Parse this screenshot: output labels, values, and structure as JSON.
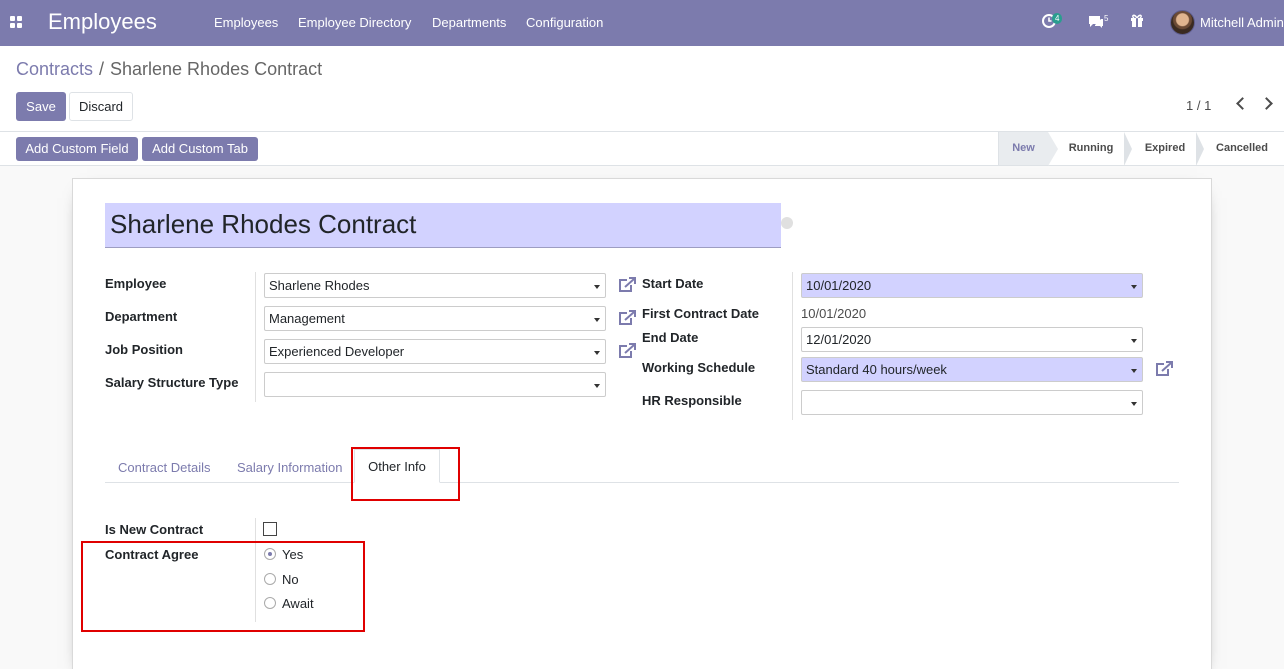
{
  "navbar": {
    "app_title": "Employees",
    "menu": [
      "Employees",
      "Employee Directory",
      "Departments",
      "Configuration"
    ],
    "activity_count": "4",
    "message_count": "5",
    "user_name": "Mitchell Admin"
  },
  "breadcrumb": {
    "parent": "Contracts",
    "separator": "/",
    "current": "Sharlene Rhodes Contract"
  },
  "buttons": {
    "save": "Save",
    "discard": "Discard",
    "add_custom_field": "Add Custom Field",
    "add_custom_tab": "Add Custom Tab"
  },
  "pager": {
    "value": "1 / 1"
  },
  "status_stages": [
    {
      "label": "New",
      "active": true
    },
    {
      "label": "Running",
      "active": false
    },
    {
      "label": "Expired",
      "active": false
    },
    {
      "label": "Cancelled",
      "active": false
    }
  ],
  "form": {
    "title": "Sharlene Rhodes Contract",
    "left": {
      "employee_label": "Employee",
      "employee_value": "Sharlene Rhodes",
      "department_label": "Department",
      "department_value": "Management",
      "job_position_label": "Job Position",
      "job_position_value": "Experienced Developer",
      "salary_structure_label": "Salary Structure Type",
      "salary_structure_value": ""
    },
    "right": {
      "start_date_label": "Start Date",
      "start_date_value": "10/01/2020",
      "first_contract_label": "First Contract Date",
      "first_contract_value": "10/01/2020",
      "end_date_label": "End Date",
      "end_date_value": "12/01/2020",
      "working_schedule_label": "Working Schedule",
      "working_schedule_value": "Standard 40 hours/week",
      "hr_responsible_label": "HR Responsible",
      "hr_responsible_value": ""
    },
    "tabs": [
      "Contract Details",
      "Salary Information",
      "Other Info"
    ],
    "active_tab": "Other Info",
    "other_info": {
      "is_new_contract_label": "Is New Contract",
      "is_new_contract_checked": false,
      "contract_agree_label": "Contract Agree",
      "options": [
        "Yes",
        "No",
        "Await"
      ],
      "selected": "Yes"
    }
  },
  "colors": {
    "brand": "#7c7bad",
    "required_field": "#d2d2ff",
    "highlight": "#e00000"
  }
}
